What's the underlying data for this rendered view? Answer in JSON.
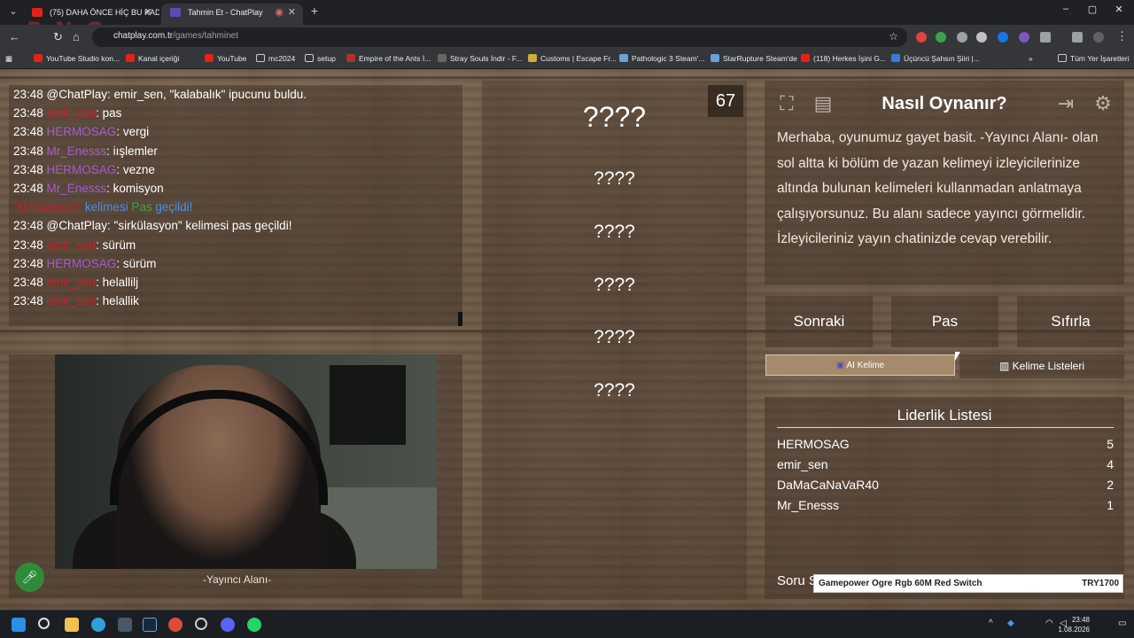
{
  "browser": {
    "tabs": [
      {
        "title": "(75) DAHA ÖNCE HİÇ BU KADA",
        "active": false
      },
      {
        "title": "Tahmin Et - ChatPlay",
        "active": true
      }
    ],
    "url_host": "chatplay.com.tr",
    "url_path": "/games/tahminet",
    "bookmarks": [
      "YouTube Studio kon...",
      "Kanal içeriği",
      "YouTube",
      "mc2024",
      "setup",
      "Empire of the Ants İ...",
      "Stray Souls İndir - F...",
      "Customs | Escape Fr...",
      "Pathologic 3 Steam'...",
      "StarRupture Steam'de",
      "(118) Herkes İşini G...",
      "Üçüncü Şahsın Şiiri |..."
    ],
    "all_bookmarks": "Tüm Yer İşaretleri",
    "overlay_logo": "ByNoGame"
  },
  "chat": {
    "messages": [
      {
        "time": "23:48",
        "user": "@ChatPlay",
        "color": "chatplay",
        "text": ": emir_sen, \"kalabalık\" ipucunu buldu."
      },
      {
        "time": "23:48",
        "user": "emir_sen",
        "color": "red",
        "text": ": pas"
      },
      {
        "time": "23:48",
        "user": "HERMOSAG",
        "color": "purple",
        "text": ": vergi"
      },
      {
        "time": "23:48",
        "user": "Mr_Enesss",
        "color": "purple",
        "text": ": iışlemler"
      },
      {
        "time": "23:48",
        "user": "HERMOSAG",
        "color": "purple",
        "text": ": vezne"
      },
      {
        "time": "23:48",
        "user": "Mr_Enesss",
        "color": "purple",
        "text": ": komisyon"
      },
      {
        "time": "",
        "user": "\"sirkülasyon\"",
        "color": "red",
        "text": "",
        "system": [
          "kelimesi",
          "Pas",
          "geçildi!"
        ]
      },
      {
        "time": "23:48",
        "user": "@ChatPlay",
        "color": "chatplay",
        "text": ": \"sirkülasyon\" kelimesi pas geçildi!"
      },
      {
        "time": "23:48",
        "user": "emir_sen",
        "color": "red",
        "text": ": sürüm"
      },
      {
        "time": "23:48",
        "user": "HERMOSAG",
        "color": "purple",
        "text": ": sürüm"
      },
      {
        "time": "23:48",
        "user": "emir_sen",
        "color": "red",
        "text": ": helallilj"
      },
      {
        "time": "23:48",
        "user": "emir_sen",
        "color": "red",
        "text": ": helallik"
      }
    ]
  },
  "streamer": {
    "label": "-Yayıncı Alanı-"
  },
  "game": {
    "timer": "67",
    "main_word": "????",
    "forbidden_words": [
      "????",
      "????",
      "????",
      "????",
      "????"
    ]
  },
  "howto": {
    "title": "Nasıl Oynanır?",
    "text": "Merhaba, oyunumuz gayet basit. -Yayıncı Alanı- olan sol altta ki bölüm de yazan kelimeyi izleyicilerinize altında bulunan kelimeleri kullanmadan anlatmaya çalışıyorsunuz. Bu alanı sadece yayıncı görmelidir. İzleyicileriniz yayın chatinizde cevap verebilir."
  },
  "controls": {
    "next": "Sonraki",
    "pass": "Pas",
    "reset": "Sıfırla",
    "ai_word": "AI Kelime",
    "word_lists": "Kelime Listeleri"
  },
  "leaderboard": {
    "title": "Liderlik Listesi",
    "rows": [
      {
        "name": "HERMOSAG",
        "score": "5"
      },
      {
        "name": "emir_sen",
        "score": "4"
      },
      {
        "name": "DaMaCaNaVaR40",
        "score": "2"
      },
      {
        "name": "Mr_Enesss",
        "score": "1"
      }
    ]
  },
  "footer": {
    "question_label": "Soru S",
    "ad_name": "Gamepower Ogre Rgb 60M Red Switch",
    "ad_price": "TRY1700"
  },
  "taskbar": {
    "time": "23:48",
    "date": "1.08.2026"
  },
  "colors": {
    "red": "#c6202a",
    "purple": "#a35ccf",
    "blue": "#4d8fe8",
    "green": "#41a33d"
  }
}
